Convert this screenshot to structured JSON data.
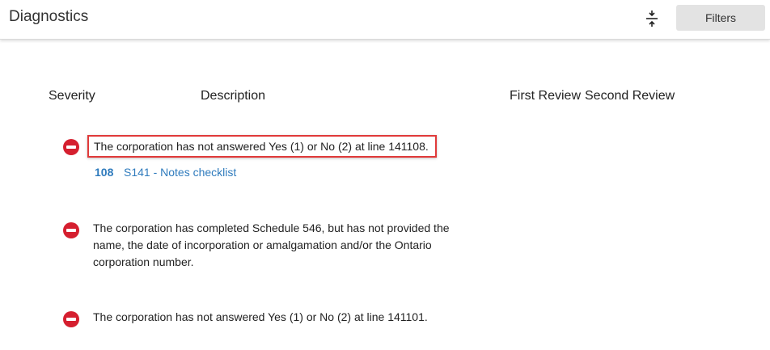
{
  "header": {
    "title": "Diagnostics",
    "collapse_icon": "collapse-vertical-icon",
    "filters_label": "Filters"
  },
  "columns": {
    "severity": "Severity",
    "description": "Description",
    "first_review": "First Review",
    "second_review": "Second Review"
  },
  "rows": [
    {
      "severity_icon": "error-stop-icon",
      "description": "The corporation has not answered Yes (1) or No (2) at line 141108.",
      "highlighted": true,
      "link_number": "108",
      "link_text": "S141 - Notes checklist"
    },
    {
      "severity_icon": "error-stop-icon",
      "description": "The corporation has completed Schedule 546, but has not provided the name, the date of incorporation or amalgamation and/or the Ontario corporation number."
    },
    {
      "severity_icon": "error-stop-icon",
      "description": "The corporation has not answered Yes (1) or No (2) at line 141101."
    }
  ],
  "colors": {
    "error": "#d51f2f",
    "link": "#2f7bbd",
    "highlight_border": "#e03a3a"
  }
}
